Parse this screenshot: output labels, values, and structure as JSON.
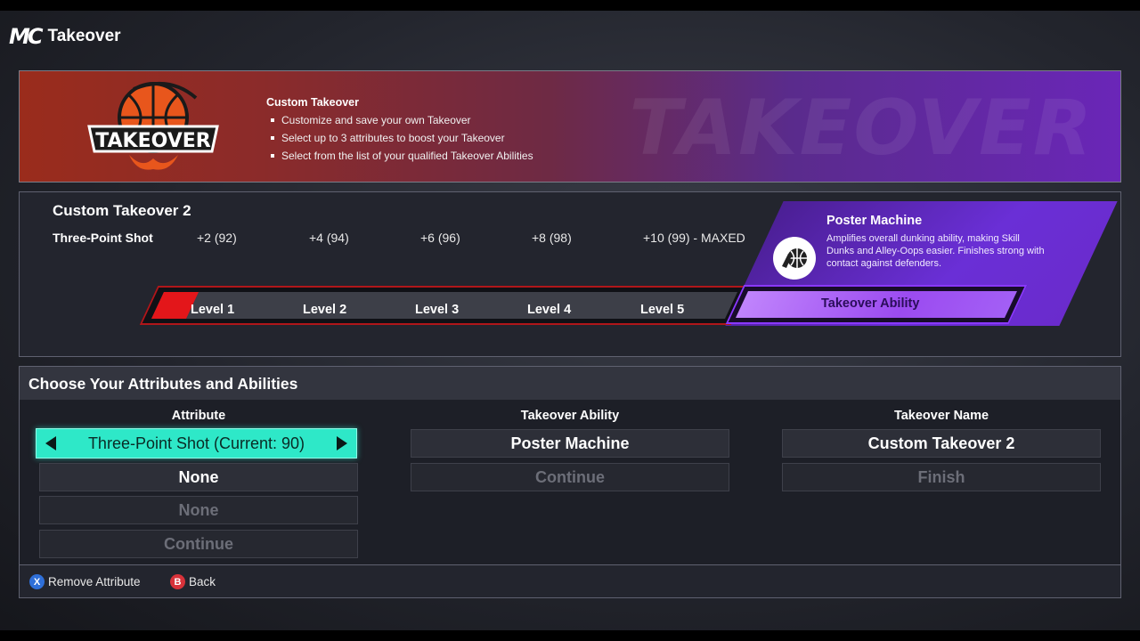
{
  "header": {
    "logo": "MC",
    "title": "Takeover"
  },
  "banner": {
    "logo_text": "TAKEOVER",
    "watermark": "TAKEOVER",
    "info_title": "Custom Takeover",
    "bullets": [
      "Customize and save your own Takeover",
      "Select up to 3 attributes to boost your Takeover",
      "Select from the list of your qualified Takeover Abilities"
    ]
  },
  "progress": {
    "name": "Custom Takeover 2",
    "attribute": "Three-Point Shot",
    "boosts": [
      "+2 (92)",
      "+4 (94)",
      "+6 (96)",
      "+8 (98)",
      "+10 (99) - MAXED"
    ],
    "levels": [
      "Level 1",
      "Level 2",
      "Level 3",
      "Level 4",
      "Level 5"
    ],
    "level_progress_fraction": 0.06,
    "ability_bar_label": "Takeover Ability",
    "ability": {
      "title": "Poster Machine",
      "description": "Amplifies overall dunking ability, making Skill Dunks and Alley-Oops easier. Finishes strong with contact against defenders.",
      "icon": "basketball-dunk-icon"
    }
  },
  "choose": {
    "title": "Choose Your Attributes and Abilities",
    "columns": {
      "attribute": {
        "header": "Attribute",
        "selected": "Three-Point Shot (Current: 90)",
        "options": [
          "None",
          "None",
          "Continue"
        ]
      },
      "ability": {
        "header": "Takeover Ability",
        "options": [
          "Poster Machine",
          "Continue"
        ]
      },
      "name": {
        "header": "Takeover Name",
        "options": [
          "Custom Takeover 2",
          "Finish"
        ]
      }
    }
  },
  "footer": {
    "remove": {
      "button": "X",
      "label": "Remove Attribute",
      "color": "#2f6fd8"
    },
    "back": {
      "button": "B",
      "label": "Back",
      "color": "#d8323a"
    }
  },
  "colors": {
    "accent_teal": "#2ee8c8",
    "level_red": "#e3161a",
    "ability_purple": "#8a38ff"
  }
}
